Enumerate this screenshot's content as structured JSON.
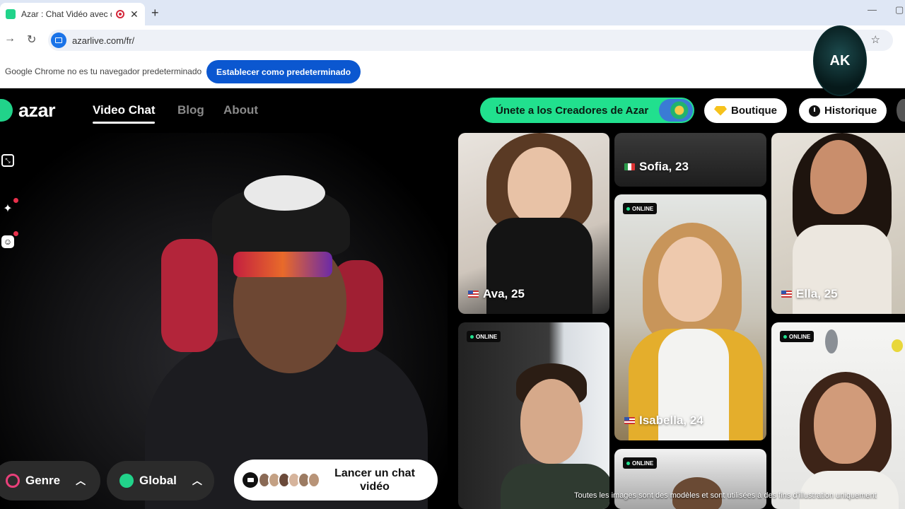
{
  "browser": {
    "tab_title": "Azar : Chat Vidéo avec de n",
    "close": "✕",
    "new_tab": "+",
    "url": "azarlive.com/fr/",
    "infobar_message": "Google Chrome no es tu navegador predeterminado",
    "set_default_label": "Establecer como predeterminado",
    "streamer_badge_text": "AK"
  },
  "header": {
    "logo_text": "azar",
    "nav": [
      "Video Chat",
      "Blog",
      "About"
    ],
    "creators_label": "Únete a los Creadores de Azar",
    "boutique_label": "Boutique",
    "history_label": "Historique"
  },
  "controls": {
    "gender_label": "Genre",
    "region_label": "Global",
    "launch_label": "Lancer un chat vidéo"
  },
  "profiles": [
    {
      "name": "Ava, 25",
      "flag": "us"
    },
    {
      "name": "Sofia, 23",
      "flag": "it"
    },
    {
      "name": "Ella, 25",
      "flag": "us"
    },
    {
      "name": "Isabella, 24",
      "flag": "us"
    }
  ],
  "online_badge": "ONLINE",
  "disclaimer": "Toutes les images sont des modèles et sont utilisées à des fins d'illustration uniquement",
  "colors": {
    "brand_green": "#21e08e",
    "chrome_button": "#0b57d0",
    "background": "#000000"
  }
}
